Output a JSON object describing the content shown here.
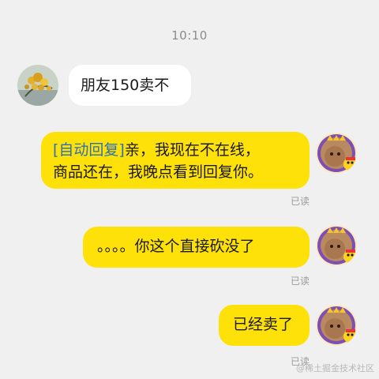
{
  "timestamp": "10:10",
  "messages": [
    {
      "side": "incoming",
      "text": "朋友150卖不"
    },
    {
      "side": "outgoing",
      "tag": "[自动回复]",
      "line1": "亲，我现在不在线，",
      "line2": "商品还在，我晚点看到回复你。",
      "status": "已读"
    },
    {
      "side": "outgoing",
      "text": "。。。。你这个直接砍没了",
      "status": "已读"
    },
    {
      "side": "outgoing",
      "text": "已经卖了",
      "status": "已读"
    }
  ],
  "watermark": "@稀土掘金技术社区"
}
